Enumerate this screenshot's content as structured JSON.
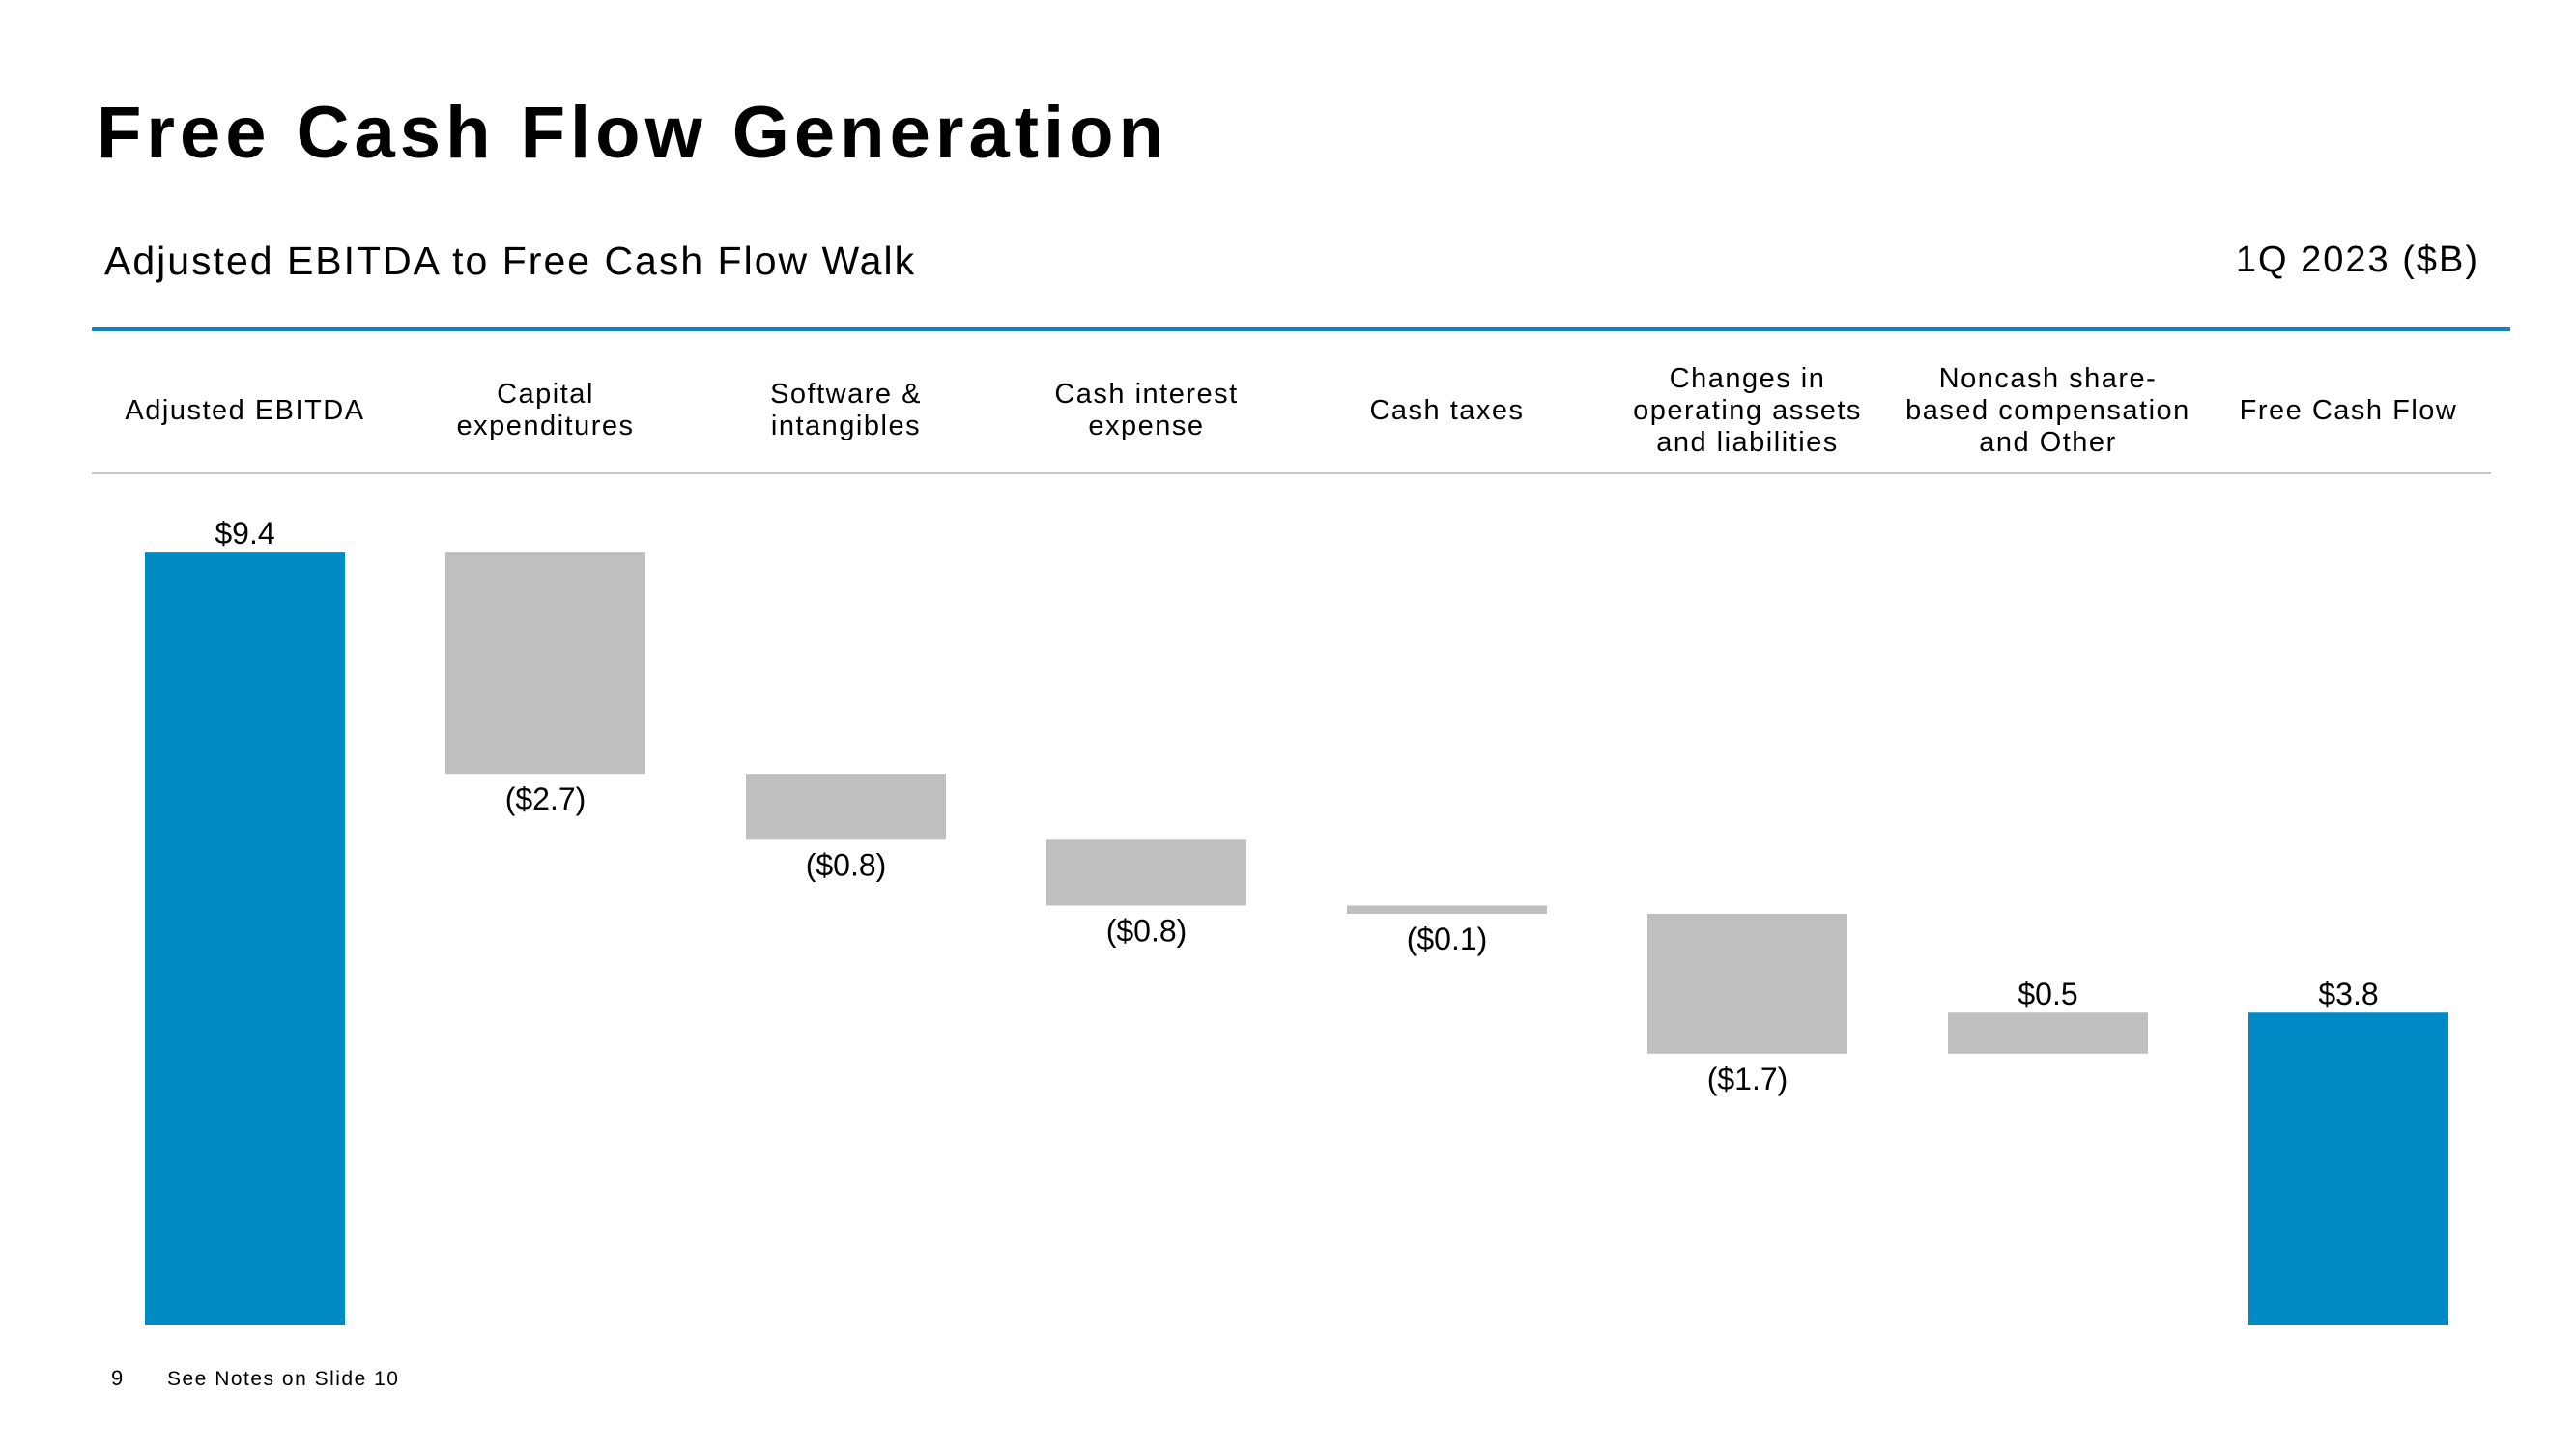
{
  "slide": {
    "title": "Free Cash Flow Generation",
    "subtitle": "Adjusted EBITDA to Free Cash Flow Walk",
    "period_label": "1Q 2023 ($B)",
    "page_number": "9",
    "footnote": "See Notes on Slide 10"
  },
  "colors": {
    "total_bar": "#008ac4",
    "delta_bar": "#bfbfbf",
    "header_rule": "#1183c2",
    "divider_rule": "#c8c8c8"
  },
  "chart_data": {
    "type": "bar",
    "subtype": "waterfall",
    "title": "Adjusted EBITDA to Free Cash Flow Walk",
    "units": "$B",
    "period": "1Q 2023",
    "categories": [
      "Adjusted EBITDA",
      "Capital\nexpenditures",
      "Software &\nintangibles",
      "Cash interest\nexpense",
      "Cash taxes",
      "Changes in\noperating assets\nand liabilities",
      "Noncash share-\nbased compensation\nand Other",
      "Free Cash Flow"
    ],
    "values": [
      9.4,
      -2.7,
      -0.8,
      -0.8,
      -0.1,
      -1.7,
      0.5,
      3.8
    ],
    "bar_kinds": [
      "total",
      "delta",
      "delta",
      "delta",
      "delta",
      "delta",
      "delta",
      "total"
    ],
    "data_labels": [
      "$9.4",
      "($2.7)",
      "($0.8)",
      "($0.8)",
      "($0.1)",
      "($1.7)",
      "$0.5",
      "$3.8"
    ],
    "xlabel": "",
    "ylabel": "",
    "ylim": [
      0,
      9.4
    ],
    "grid": false,
    "legend": "none"
  }
}
